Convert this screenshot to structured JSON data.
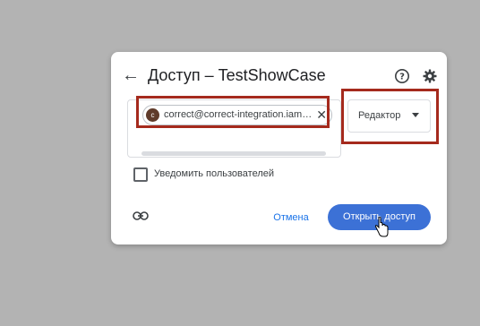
{
  "dialog": {
    "back_icon": "arrow-left-icon",
    "title": "Доступ – TestShowCase",
    "help_icon": "help-circle-icon",
    "settings_icon": "gear-icon"
  },
  "recipient": {
    "avatar_letter": "c",
    "email": "correct@correct-integration.iam....",
    "remove_icon": "close-icon"
  },
  "role": {
    "selected": "Редактор"
  },
  "notify": {
    "label": "Уведомить пользователей",
    "checked": false
  },
  "actions": {
    "copy_link_icon": "link-icon",
    "cancel_label": "Отмена",
    "share_label": "Открыть доступ"
  },
  "colors": {
    "accent": "#1a73e8",
    "primary_button": "#3c71d6",
    "highlight_box": "#a52a1d",
    "backdrop": "#b3b3b3"
  }
}
